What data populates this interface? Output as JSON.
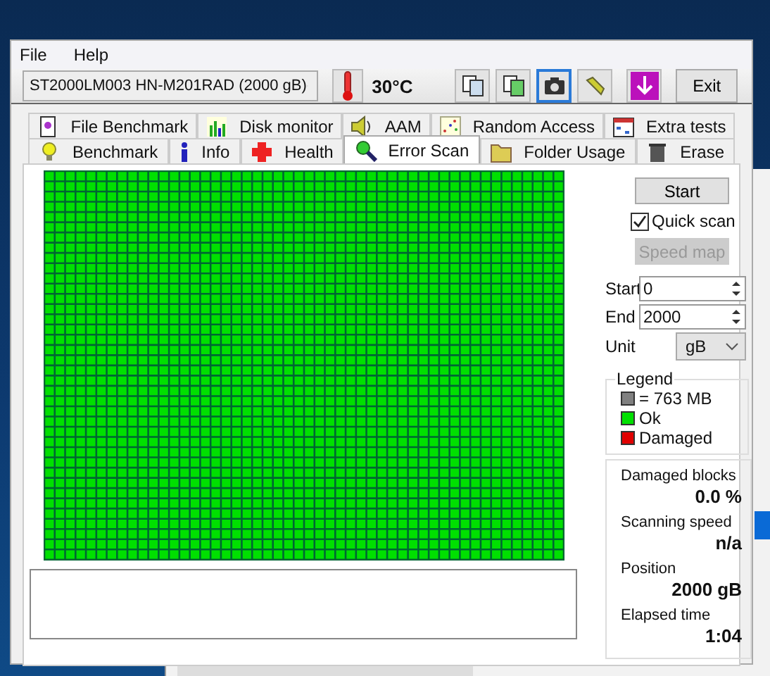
{
  "menu": [
    "File",
    "Help"
  ],
  "toolbar": {
    "drive": "ST2000LM003 HN-M201RAD (2000 gB)",
    "temperature": "30°C",
    "tools": [
      {
        "focused": false
      },
      {
        "focused": false
      },
      {
        "focused": true
      },
      {
        "focused": false
      },
      {
        "focused": false
      }
    ],
    "exit": "Exit"
  },
  "tab_rows": [
    [
      {
        "label": "File Benchmark",
        "selected": false
      },
      {
        "label": "Disk monitor",
        "selected": false
      },
      {
        "label": "AAM",
        "selected": false
      },
      {
        "label": "Random Access",
        "selected": false
      },
      {
        "label": "Extra tests",
        "selected": false
      }
    ],
    [
      {
        "label": "Benchmark",
        "selected": false
      },
      {
        "label": "Info",
        "selected": false
      },
      {
        "label": "Health",
        "selected": false
      },
      {
        "label": "Error Scan",
        "selected": true
      },
      {
        "label": "Folder Usage",
        "selected": false
      },
      {
        "label": "Erase",
        "selected": false
      }
    ]
  ],
  "controls": {
    "start": "Start",
    "quick_scan": {
      "label": "Quick scan",
      "checked": true
    },
    "speed_map": {
      "label": "Speed map",
      "disabled": true
    },
    "start_field": {
      "label": "Start",
      "value": "0"
    },
    "end_field": {
      "label": "End",
      "value": "2000"
    },
    "unit": {
      "label": "Unit",
      "value": "gB"
    }
  },
  "legend": {
    "title": "Legend",
    "items": [
      {
        "label": "= 763 MB",
        "color": "#808080"
      },
      {
        "label": "Ok",
        "color": "#00e000"
      },
      {
        "label": "Damaged",
        "color": "#e00000"
      }
    ]
  },
  "stats": [
    {
      "label": "Damaged blocks",
      "value": "0.0 %"
    },
    {
      "label": "Scanning speed",
      "value": "n/a"
    },
    {
      "label": "Position",
      "value": "2000 gB"
    },
    {
      "label": "Elapsed time",
      "value": "1:04"
    }
  ]
}
